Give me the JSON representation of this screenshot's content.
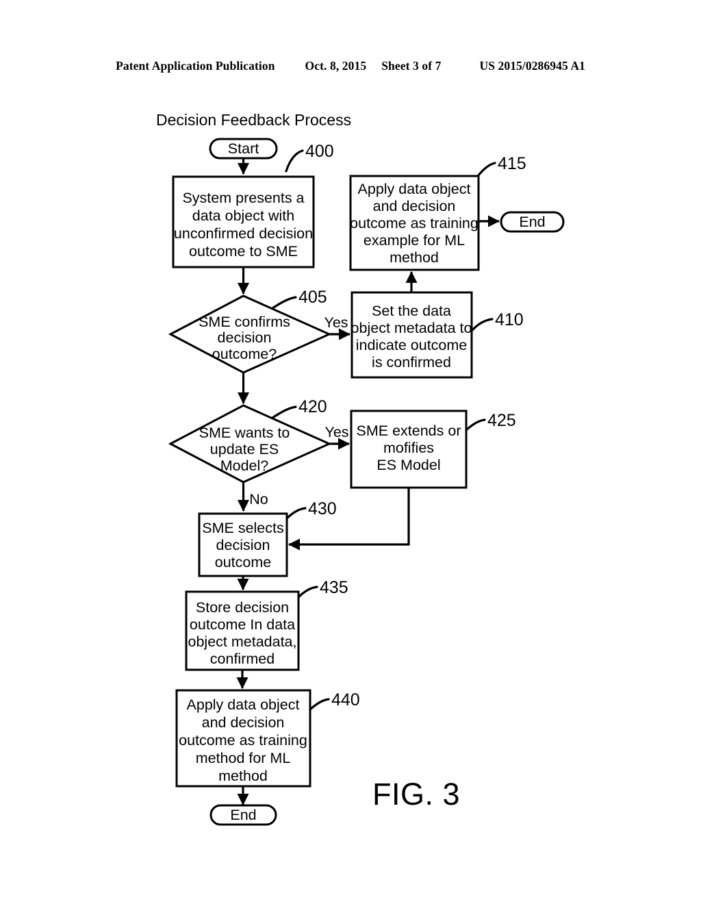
{
  "header": {
    "publication": "Patent Application Publication",
    "date": "Oct. 8, 2015",
    "sheet": "Sheet 3 of 7",
    "number": "US 2015/0286945 A1"
  },
  "figure": {
    "title": "Decision Feedback Process",
    "caption": "FIG. 3"
  },
  "terminals": {
    "start": "Start",
    "end_top": "End",
    "end_bottom": "End"
  },
  "branch_labels": {
    "yes_405": "Yes",
    "yes_420": "Yes",
    "no_420": "No"
  },
  "nodes": [
    {
      "ref": "400",
      "type": "process",
      "lines": [
        "System presents a",
        "data object with",
        "unconfirmed decision",
        "outcome to SME"
      ]
    },
    {
      "ref": "405",
      "type": "decision",
      "lines": [
        "SME confirms",
        "decision",
        "outcome?"
      ]
    },
    {
      "ref": "410",
      "type": "process",
      "lines": [
        "Set the data",
        "object metadata to",
        "indicate outcome",
        "is confirmed"
      ]
    },
    {
      "ref": "415",
      "type": "process",
      "lines": [
        "Apply data object",
        "and decision",
        "outcome as training",
        "example for ML",
        "method"
      ]
    },
    {
      "ref": "420",
      "type": "decision",
      "lines": [
        "SME wants to",
        "update ES",
        "Model?"
      ]
    },
    {
      "ref": "425",
      "type": "process",
      "lines": [
        "SME extends or",
        "mofifies",
        "ES Model"
      ]
    },
    {
      "ref": "430",
      "type": "process",
      "lines": [
        "SME selects",
        "decision",
        "outcome"
      ]
    },
    {
      "ref": "435",
      "type": "process",
      "lines": [
        "Store decision",
        "outcome In data",
        "object metadata,",
        "confirmed"
      ]
    },
    {
      "ref": "440",
      "type": "process",
      "lines": [
        "Apply data object",
        "and decision",
        "outcome as training",
        "method for ML",
        "method"
      ]
    }
  ],
  "colors": {
    "ink": "#000000",
    "paper": "#ffffff"
  }
}
